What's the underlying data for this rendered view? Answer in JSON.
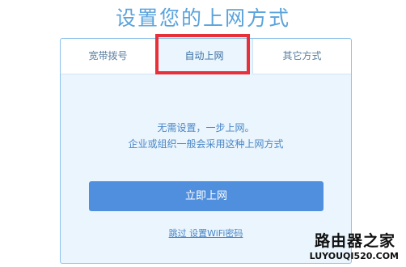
{
  "page": {
    "title": "设置您的上网方式"
  },
  "tabs": [
    {
      "label": "宽带拨号",
      "active": false
    },
    {
      "label": "自动上网",
      "active": true
    },
    {
      "label": "其它方式",
      "active": false
    }
  ],
  "content": {
    "line1": "无需设置，一步上网。",
    "line2": "企业或组织一般会采用这种上网方式",
    "primary_button": "立即上网",
    "skip_link": "跳过 设置WiFi密码"
  },
  "annotation": {
    "highlight_color": "#e8303a"
  },
  "watermark": {
    "cn": "路由器之家",
    "en": "LUYOUQI520.COM"
  },
  "colors": {
    "accent": "#4f8fdd",
    "title": "#5aa3dc",
    "panel_bg": "#eaf5fd"
  }
}
